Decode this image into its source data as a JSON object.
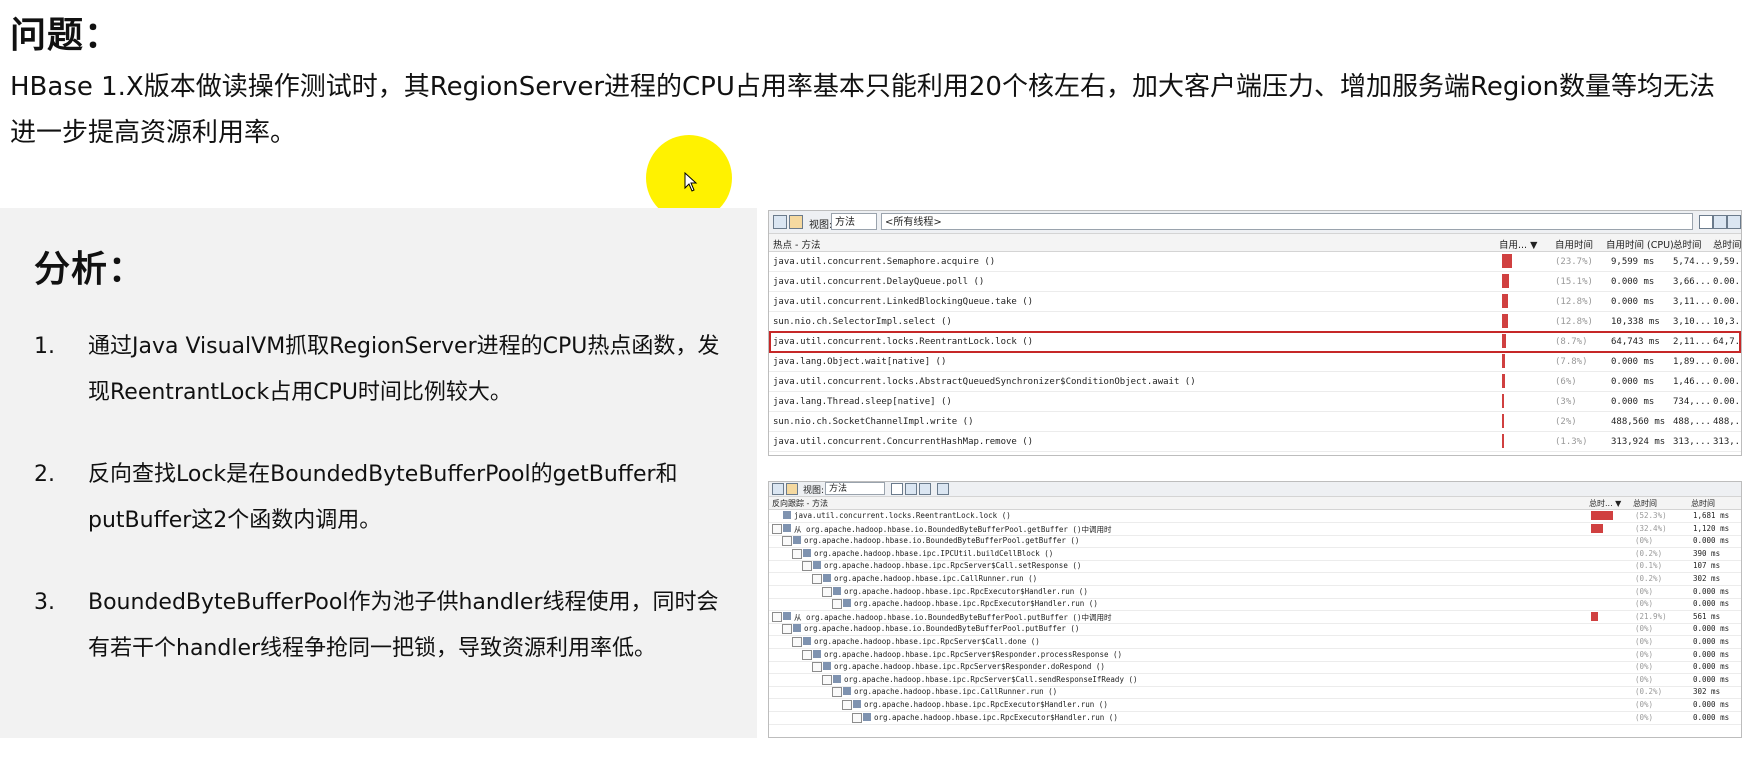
{
  "problem": {
    "title": "问题：",
    "text": "HBase 1.X版本做读操作测试时，其RegionServer进程的CPU占用率基本只能利用20个核左右，加大客户端压力、增加服务端Region数量等均无法进一步提高资源利用率。"
  },
  "analysis": {
    "title": "分析：",
    "items": [
      {
        "num": "1.",
        "text": "通过Java VisualVM抓取RegionServer进程的CPU热点函数，发现ReentrantLock占用CPU时间比例较大。"
      },
      {
        "num": "2.",
        "text": "反向查找Lock是在BoundedByteBufferPool的getBuffer和putBuffer这2个函数内调用。"
      },
      {
        "num": "3.",
        "text": "BoundedByteBufferPool作为池子供handler线程使用，同时会有若干个handler线程争抢同一把锁，导致资源利用率低。"
      }
    ]
  },
  "hotspots": {
    "view_label": "视图:",
    "view_value": "方法",
    "thread_value": "<所有线程>",
    "columns": [
      "热点 - 方法",
      "自用... ▼",
      "自用时间",
      "自用时间 (CPU)",
      "总时间",
      "总时间"
    ],
    "rows": [
      {
        "method": "java.util.concurrent.Semaphore.acquire ()",
        "pct": "(23.7%)",
        "bar": 0.86,
        "cpu": "9,599 ms",
        "total": "5,74...",
        "total2": "9,59..."
      },
      {
        "method": "java.util.concurrent.DelayQueue.poll ()",
        "pct": "(15.1%)",
        "bar": 0.55,
        "cpu": "0.000 ms",
        "total": "3,66...",
        "total2": "0.00..."
      },
      {
        "method": "java.util.concurrent.LinkedBlockingQueue.take ()",
        "pct": "(12.8%)",
        "bar": 0.46,
        "cpu": "0.000 ms",
        "total": "3,11...",
        "total2": "0.00..."
      },
      {
        "method": "sun.nio.ch.SelectorImpl.select ()",
        "pct": "(12.8%)",
        "bar": 0.46,
        "cpu": "10,338 ms",
        "total": "3,10...",
        "total2": "10,3..."
      },
      {
        "method": "java.util.concurrent.locks.ReentrantLock.lock ()",
        "pct": "(8.7%)",
        "bar": 0.32,
        "cpu": "64,743 ms",
        "total": "2,11...",
        "total2": "64,7...",
        "selected": true
      },
      {
        "method": "java.lang.Object.wait[native] ()",
        "pct": "(7.8%)",
        "bar": 0.28,
        "cpu": "0.000 ms",
        "total": "1,89...",
        "total2": "0.00..."
      },
      {
        "method": "java.util.concurrent.locks.AbstractQueuedSynchronizer$ConditionObject.await ()",
        "pct": "(6%)",
        "bar": 0.22,
        "cpu": "0.000 ms",
        "total": "1,46...",
        "total2": "0.00..."
      },
      {
        "method": "java.lang.Thread.sleep[native] ()",
        "pct": "(3%)",
        "bar": 0.11,
        "cpu": "0.000 ms",
        "total": "734,...",
        "total2": "0.00..."
      },
      {
        "method": "sun.nio.ch.SocketChannelImpl.write ()",
        "pct": "(2%)",
        "bar": 0.07,
        "cpu": "488,560 ms",
        "total": "488,...",
        "total2": "488,..."
      },
      {
        "method": "java.util.concurrent.ConcurrentHashMap.remove ()",
        "pct": "(1.3%)",
        "bar": 0.05,
        "cpu": "313,924 ms",
        "total": "313,...",
        "total2": "313,..."
      }
    ]
  },
  "backtrace": {
    "view_label": "视图:",
    "view_value": "方法",
    "columns": [
      "反向跟踪 - 方法",
      "总时... ▼",
      "总时间",
      "总时间"
    ],
    "rows": [
      {
        "level": 0,
        "method": "java.util.concurrent.locks.ReentrantLock.lock ()",
        "pct": "(52.3%)",
        "bar": 1.0,
        "time": "1,681 ms"
      },
      {
        "level": 0,
        "method": "从 org.apache.hadoop.hbase.io.BoundedByteBufferPool.getBuffer ()中调用时",
        "pct": "(32.4%)",
        "bar": 0.55,
        "time": "1,120 ms"
      },
      {
        "level": 1,
        "method": "org.apache.hadoop.hbase.io.BoundedByteBufferPool.getBuffer ()",
        "pct": "(0%)",
        "bar": 0,
        "time": "0.000 ms"
      },
      {
        "level": 2,
        "method": "org.apache.hadoop.hbase.ipc.IPCUtil.buildCellBlock ()",
        "pct": "(0.2%)",
        "bar": 0,
        "time": "390 ms"
      },
      {
        "level": 3,
        "method": "org.apache.hadoop.hbase.ipc.RpcServer$Call.setResponse ()",
        "pct": "(0.1%)",
        "bar": 0,
        "time": "107 ms"
      },
      {
        "level": 4,
        "method": "org.apache.hadoop.hbase.ipc.CallRunner.run ()",
        "pct": "(0.2%)",
        "bar": 0,
        "time": "302 ms"
      },
      {
        "level": 5,
        "method": "org.apache.hadoop.hbase.ipc.RpcExecutor$Handler.run ()",
        "pct": "(0%)",
        "bar": 0,
        "time": "0.000 ms"
      },
      {
        "level": 6,
        "method": "org.apache.hadoop.hbase.ipc.RpcExecutor$Handler.run ()",
        "pct": "(0%)",
        "bar": 0,
        "time": "0.000 ms"
      },
      {
        "level": 0,
        "method": "从 org.apache.hadoop.hbase.io.BoundedByteBufferPool.putBuffer ()中调用时",
        "pct": "(21.9%)",
        "bar": 0.33,
        "time": "561 ms"
      },
      {
        "level": 1,
        "method": "org.apache.hadoop.hbase.io.BoundedByteBufferPool.putBuffer ()",
        "pct": "(0%)",
        "bar": 0,
        "time": "0.000 ms"
      },
      {
        "level": 2,
        "method": "org.apache.hadoop.hbase.ipc.RpcServer$Call.done ()",
        "pct": "(0%)",
        "bar": 0,
        "time": "0.000 ms"
      },
      {
        "level": 3,
        "method": "org.apache.hadoop.hbase.ipc.RpcServer$Responder.processResponse ()",
        "pct": "(0%)",
        "bar": 0,
        "time": "0.000 ms"
      },
      {
        "level": 4,
        "method": "org.apache.hadoop.hbase.ipc.RpcServer$Responder.doRespond ()",
        "pct": "(0%)",
        "bar": 0,
        "time": "0.000 ms"
      },
      {
        "level": 5,
        "method": "org.apache.hadoop.hbase.ipc.RpcServer$Call.sendResponseIfReady ()",
        "pct": "(0%)",
        "bar": 0,
        "time": "0.000 ms"
      },
      {
        "level": 6,
        "method": "org.apache.hadoop.hbase.ipc.CallRunner.run ()",
        "pct": "(0.2%)",
        "bar": 0,
        "time": "302 ms"
      },
      {
        "level": 7,
        "method": "org.apache.hadoop.hbase.ipc.RpcExecutor$Handler.run ()",
        "pct": "(0%)",
        "bar": 0,
        "time": "0.000 ms"
      },
      {
        "level": 8,
        "method": "org.apache.hadoop.hbase.ipc.RpcExecutor$Handler.run ()",
        "pct": "(0%)",
        "bar": 0,
        "time": "0.000 ms"
      }
    ]
  }
}
